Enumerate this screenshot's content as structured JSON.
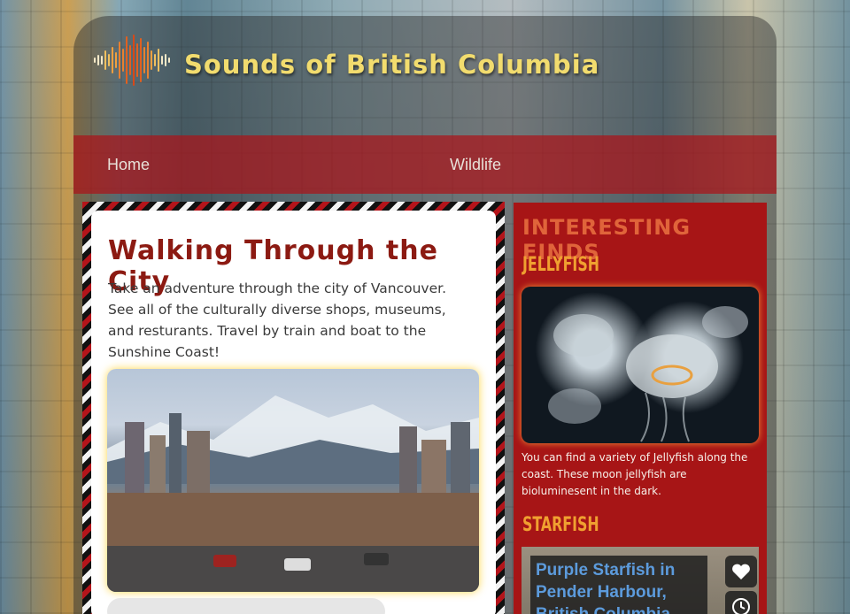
{
  "site": {
    "title": "Sounds of British Columbia",
    "logo_icon": "sound-wave-logo"
  },
  "nav": {
    "items": [
      "Home",
      "Wildlife"
    ]
  },
  "article": {
    "title": "Walking Through the City",
    "text": "Take an adventure through the city of Vancouver. See all of the culturally diverse shops, museums, and resturants. Travel by train and boat to the Sunshine Coast!"
  },
  "sidebar": {
    "heading": "INTERESTING FINDS",
    "finds": [
      {
        "title": "JELLYFISH",
        "text": "You can find a variety of Jellyfish along the coast. These moon jellyfish are bioluminesent in the dark."
      },
      {
        "title": "STARFISH",
        "video_title": "Purple Starfish in Pender Harbour, British Columbia",
        "icons": [
          "heart-icon",
          "clock-icon"
        ]
      }
    ]
  },
  "colors": {
    "title_gold": "#f2dc6e",
    "nav_red": "#aa1419",
    "sidebar_red": "#a71516",
    "find_orange": "#f0a030",
    "heading_orange": "#e0643a",
    "article_title": "#8c1a12"
  }
}
